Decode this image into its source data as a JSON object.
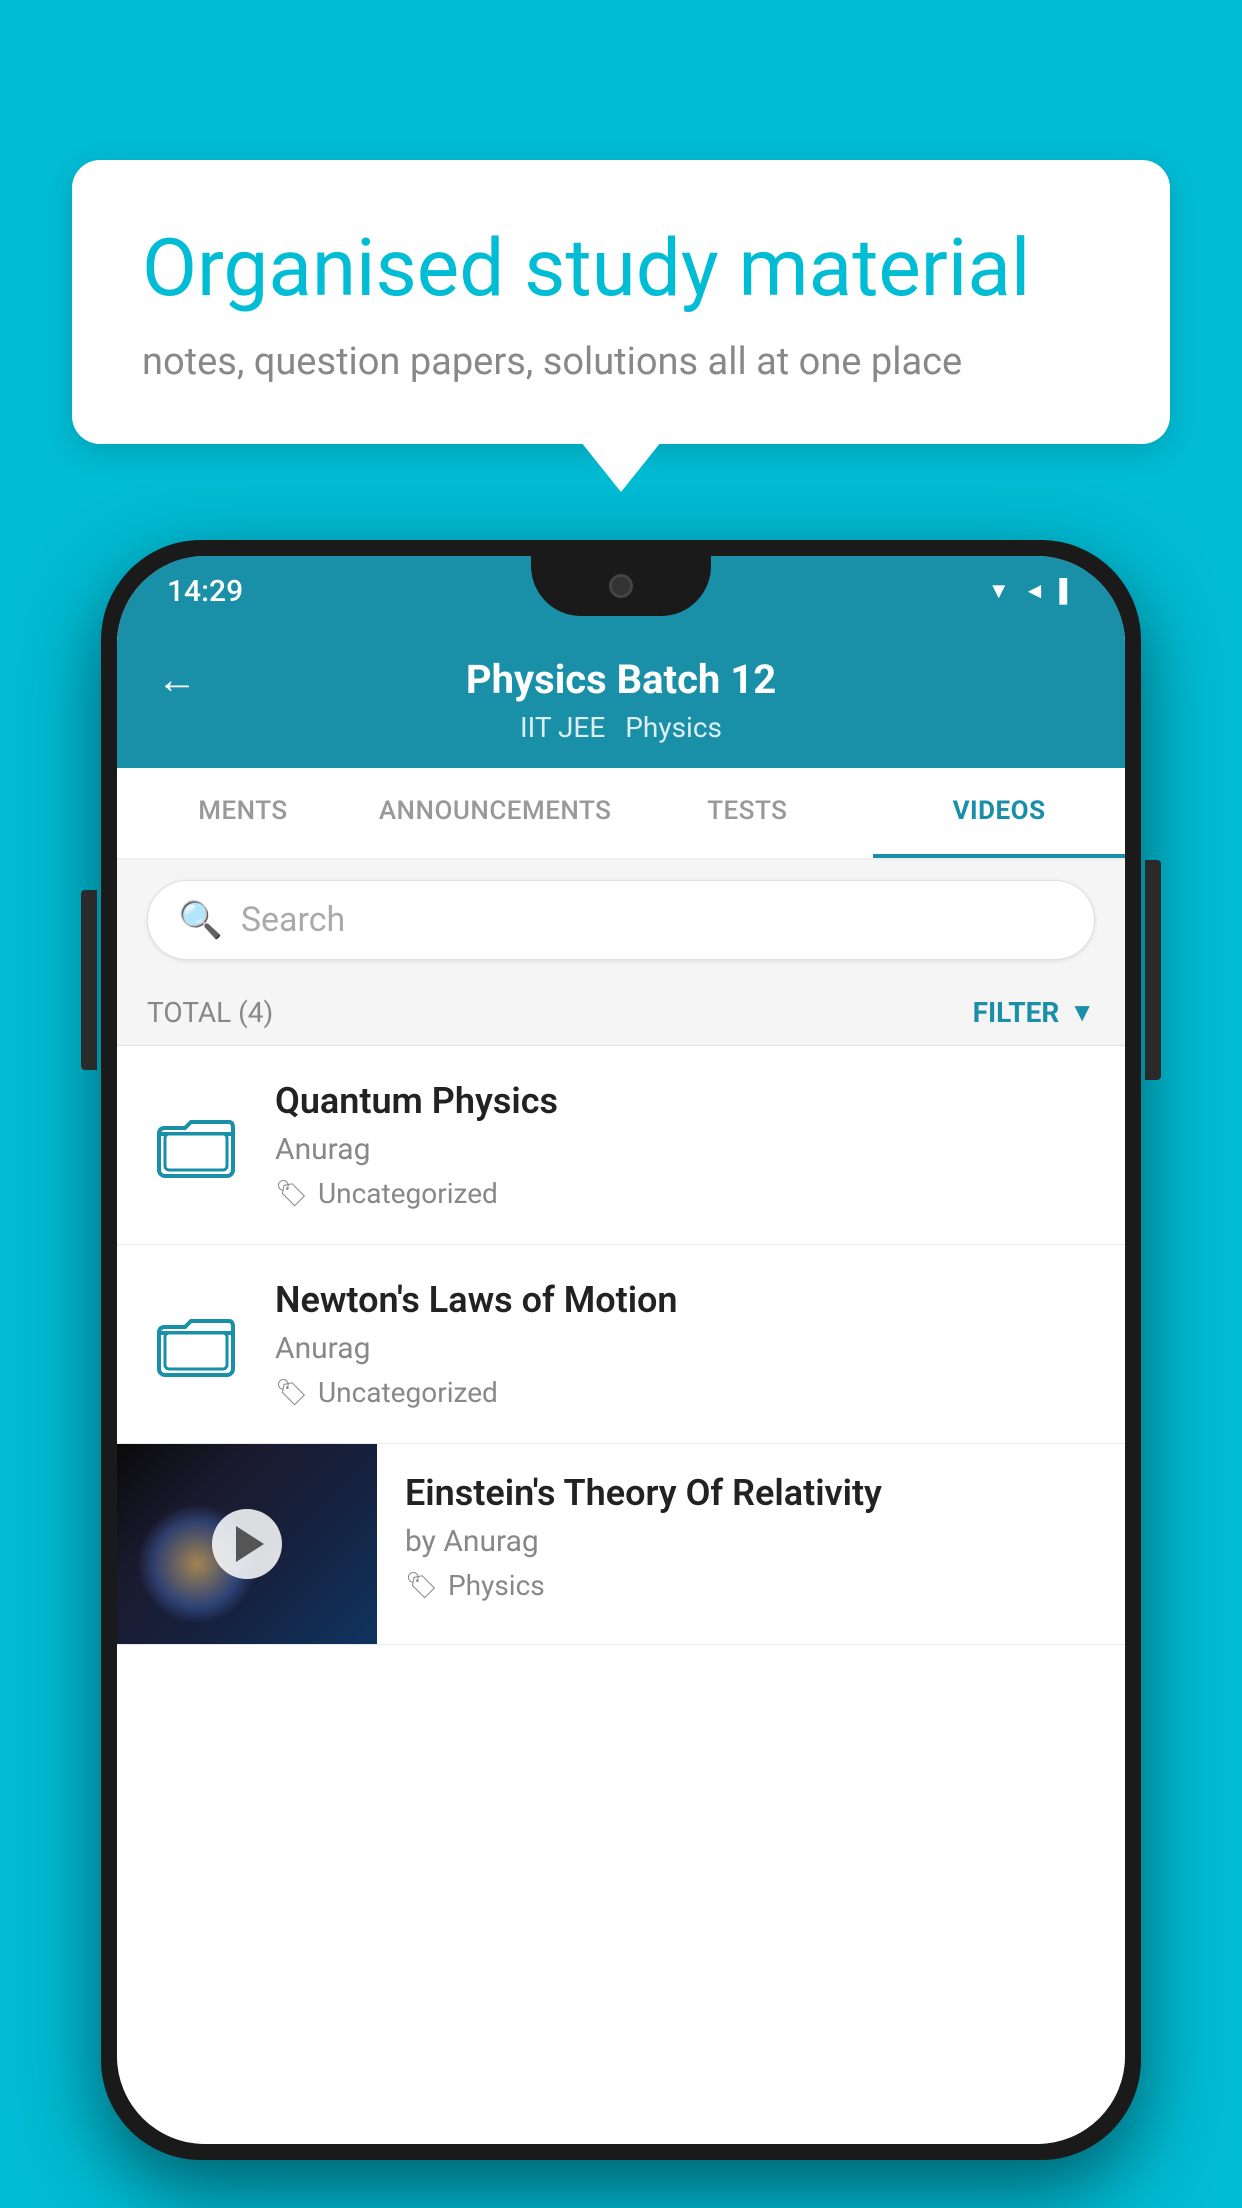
{
  "background_color": "#00BCD4",
  "speech_bubble": {
    "title": "Organised study material",
    "subtitle": "notes, question papers, solutions all at one place"
  },
  "phone": {
    "status_bar": {
      "time": "14:29",
      "icons": [
        "wifi",
        "signal",
        "battery"
      ]
    },
    "header": {
      "back_label": "←",
      "title": "Physics Batch 12",
      "subtitle_left": "IIT JEE",
      "subtitle_right": "Physics"
    },
    "tabs": [
      {
        "label": "MENTS",
        "active": false
      },
      {
        "label": "ANNOUNCEMENTS",
        "active": false
      },
      {
        "label": "TESTS",
        "active": false
      },
      {
        "label": "VIDEOS",
        "active": true
      }
    ],
    "search": {
      "placeholder": "Search"
    },
    "filter": {
      "total_label": "TOTAL (4)",
      "filter_label": "FILTER"
    },
    "videos": [
      {
        "id": 1,
        "title": "Quantum Physics",
        "author": "Anurag",
        "tag": "Uncategorized",
        "has_thumbnail": false
      },
      {
        "id": 2,
        "title": "Newton's Laws of Motion",
        "author": "Anurag",
        "tag": "Uncategorized",
        "has_thumbnail": false
      },
      {
        "id": 3,
        "title": "Einstein's Theory Of Relativity",
        "author": "by Anurag",
        "tag": "Physics",
        "has_thumbnail": true
      }
    ]
  }
}
